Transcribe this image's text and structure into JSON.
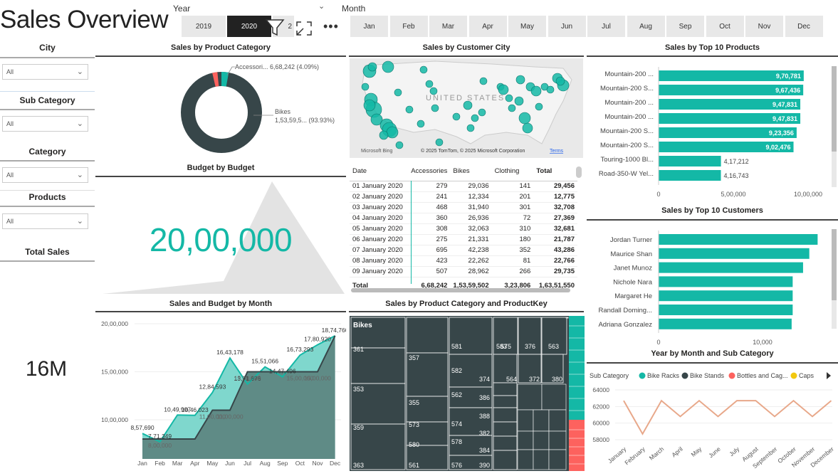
{
  "page_title": "Sales Overview",
  "colors": {
    "teal": "#14b8a6",
    "dark": "#374649",
    "red": "#fd625e",
    "yellow": "#f2c80f",
    "line": "#e8a88a"
  },
  "year_slicer": {
    "label": "Year",
    "tiles": [
      "2019",
      "2020",
      "2"
    ],
    "selected": "2020"
  },
  "month_slicer": {
    "label": "Month",
    "tiles": [
      "Jan",
      "Feb",
      "Mar",
      "Apr",
      "May",
      "Jun",
      "Jul",
      "Aug",
      "Sep",
      "Oct",
      "Nov",
      "Dec"
    ]
  },
  "sidebar": {
    "city": {
      "label": "City",
      "value": "All"
    },
    "subcategory": {
      "label": "Sub Category",
      "value": "All"
    },
    "category": {
      "label": "Category",
      "value": "All"
    },
    "products": {
      "label": "Products",
      "value": "All"
    },
    "total_sales": {
      "label": "Total Sales",
      "value": "16M"
    }
  },
  "donut": {
    "title": "Sales by Product Category",
    "label_acc": "Accessori... 6,68,242 (4.09%)",
    "label_bikes_1": "Bikes",
    "label_bikes_2": "1,53,59,5... (93.93%)"
  },
  "map": {
    "title": "Sales by Customer City",
    "country": "UNITED STATES",
    "bing": "Microsoft Bing",
    "copyright": "© 2025 TomTom, © 2025 Microsoft Corporation",
    "terms": "Terms"
  },
  "budget": {
    "title": "Budget by Budget",
    "value": "20,00,000"
  },
  "table": {
    "headers": [
      "Date",
      "Accessories",
      "Bikes",
      "Clothing",
      "Total"
    ],
    "rows": [
      [
        "01 January 2020",
        "279",
        "29,036",
        "141",
        "29,456"
      ],
      [
        "02 January 2020",
        "241",
        "12,334",
        "201",
        "12,775"
      ],
      [
        "03 January 2020",
        "468",
        "31,940",
        "301",
        "32,708"
      ],
      [
        "04 January 2020",
        "360",
        "26,936",
        "72",
        "27,369"
      ],
      [
        "05 January 2020",
        "308",
        "32,063",
        "310",
        "32,681"
      ],
      [
        "06 January 2020",
        "275",
        "21,331",
        "180",
        "21,787"
      ],
      [
        "07 January 2020",
        "695",
        "42,238",
        "352",
        "43,286"
      ],
      [
        "08 January 2020",
        "423",
        "22,262",
        "81",
        "22,766"
      ],
      [
        "09 January 2020",
        "507",
        "28,962",
        "266",
        "29,735"
      ]
    ],
    "total": [
      "Total",
      "6,68,242",
      "1,53,59,502",
      "3,23,806",
      "1,63,51,550"
    ]
  },
  "top_products": {
    "title": "Sales by Top 10 Products",
    "ticks": [
      "0",
      "5,00,000",
      "10,00,000"
    ],
    "items": [
      {
        "label": "Mountain-200 ...",
        "value": 970781,
        "text": "9,70,781"
      },
      {
        "label": "Mountain-200 S...",
        "value": 967436,
        "text": "9,67,436"
      },
      {
        "label": "Mountain-200 ...",
        "value": 947831,
        "text": "9,47,831"
      },
      {
        "label": "Mountain-200 ...",
        "value": 947831,
        "text": "9,47,831"
      },
      {
        "label": "Mountain-200 S...",
        "value": 923356,
        "text": "9,23,356"
      },
      {
        "label": "Mountain-200 S...",
        "value": 902476,
        "text": "9,02,476"
      },
      {
        "label": "Touring-1000 Bl...",
        "value": 417212,
        "text": "4,17,212"
      },
      {
        "label": "Road-350-W Yel...",
        "value": 416743,
        "text": "4,16,743"
      }
    ]
  },
  "top_customers": {
    "title": "Sales by Top 10 Customers",
    "ticks": [
      "0",
      "10,000"
    ],
    "items": [
      {
        "label": "Jordan Turner",
        "value": 15300
      },
      {
        "label": "Maurice Shan",
        "value": 14500
      },
      {
        "label": "Janet Munoz",
        "value": 13900
      },
      {
        "label": "Nichole Nara",
        "value": 12900
      },
      {
        "label": "Margaret He",
        "value": 12900
      },
      {
        "label": "Randall Doming...",
        "value": 12900
      },
      {
        "label": "Adriana Gonzalez",
        "value": 12800
      }
    ]
  },
  "sales_budget": {
    "title": "Sales and Budget by Month",
    "yticks": [
      "20,00,000",
      "15,00,000",
      "10,00,000"
    ],
    "months": [
      "Jan",
      "Feb",
      "Mar",
      "Apr",
      "May",
      "Jun",
      "Jul",
      "Aug",
      "Sep",
      "Oct",
      "Nov",
      "Dec"
    ],
    "sales_labels": [
      "8,57,690",
      "7,71,349",
      "10,49,907",
      "10,46,023",
      "12,84,593",
      "16,43,178",
      "13,71,676",
      "15,51,066",
      "14,47,496",
      "16,73,293",
      "17,80,920",
      "18,74,760"
    ],
    "budget_labels": [
      "",
      "8,00,000",
      "",
      "",
      "11,00,000",
      "11,00,000",
      "15,00,000",
      "",
      "",
      "15,00,000",
      "15,00,000",
      ""
    ]
  },
  "treemap": {
    "title": "Sales by Product Category and ProductKey",
    "header": "Bikes",
    "labels": [
      "361",
      "353",
      "359",
      "363",
      "357",
      "355",
      "573",
      "580",
      "561",
      "581",
      "582",
      "562",
      "574",
      "578",
      "576",
      "583",
      "374",
      "386",
      "388",
      "382",
      "384",
      "390",
      "575",
      "564",
      "376",
      "372",
      "563",
      "380"
    ]
  },
  "month_sub": {
    "title": "Year by Month and Sub Category",
    "legend_label": "Sub Category",
    "legend": [
      "Bike Racks",
      "Bike Stands",
      "Bottles and Cag...",
      "Caps"
    ],
    "yticks": [
      "64000",
      "62000",
      "60000",
      "58000"
    ],
    "months": [
      "January",
      "February",
      "March",
      "April",
      "May",
      "June",
      "July",
      "August",
      "September",
      "October",
      "November",
      "December"
    ],
    "values": [
      62700,
      58700,
      62700,
      60800,
      62700,
      60800,
      62700,
      62700,
      60800,
      62700,
      60800,
      62700
    ]
  }
}
